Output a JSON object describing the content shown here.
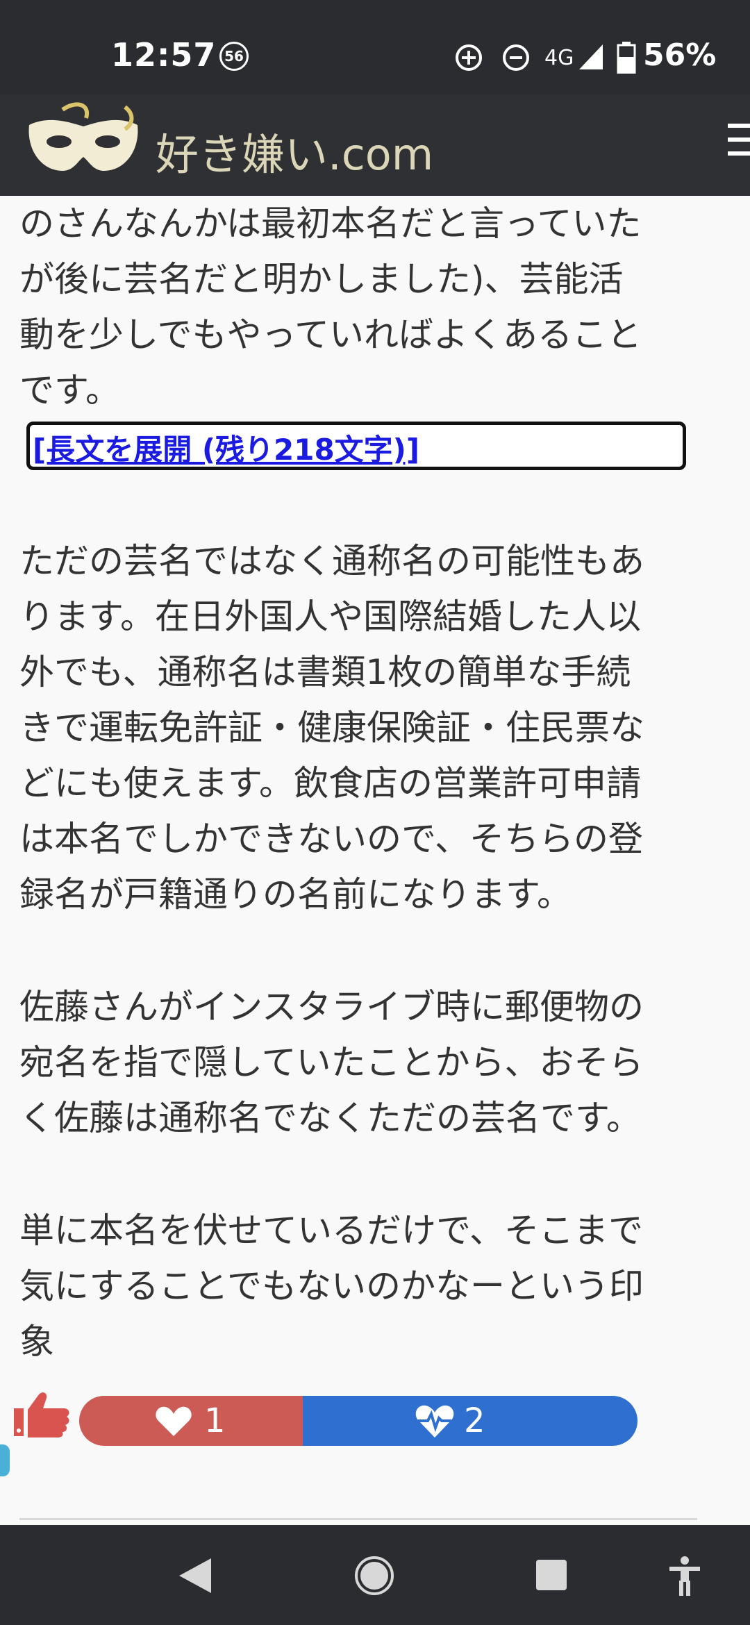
{
  "status_bar": {
    "time": "12:57",
    "badge": "56",
    "network": "4G",
    "battery": "56%"
  },
  "header": {
    "site_name": "好き嫌い.com"
  },
  "article": {
    "para1": [
      "のさんなんかは最初本名だと言っていた",
      "が後に芸名だと明かしました)、芸能活",
      "動を少しでもやっていればよくあること",
      "です。"
    ],
    "expand_link": "[長文を展開 (残り218文字)]",
    "para2": [
      "ただの芸名ではなく通称名の可能性もあ",
      "ります。在日外国人や国際結婚した人以",
      "外でも、通称名は書類1枚の簡単な手続",
      "きで運転免許証・健康保険証・住民票な",
      "どにも使えます。飲食店の営業許可申請",
      "は本名でしかできないので、そちらの登",
      "録名が戸籍通りの名前になります。"
    ],
    "para3": [
      "佐藤さんがインスタライブ時に郵便物の",
      "宛名を指で隠していたことから、おそら",
      "く佐藤は通称名でなくただの芸名です。"
    ],
    "para4": [
      "単に本名を伏せているだけで、そこまで",
      "気にすることでもないのかなーという印",
      "象"
    ]
  },
  "votes": {
    "like_count": "1",
    "love_count": "2",
    "like_color": "#cc5b56",
    "love_color": "#2e6fcf"
  }
}
